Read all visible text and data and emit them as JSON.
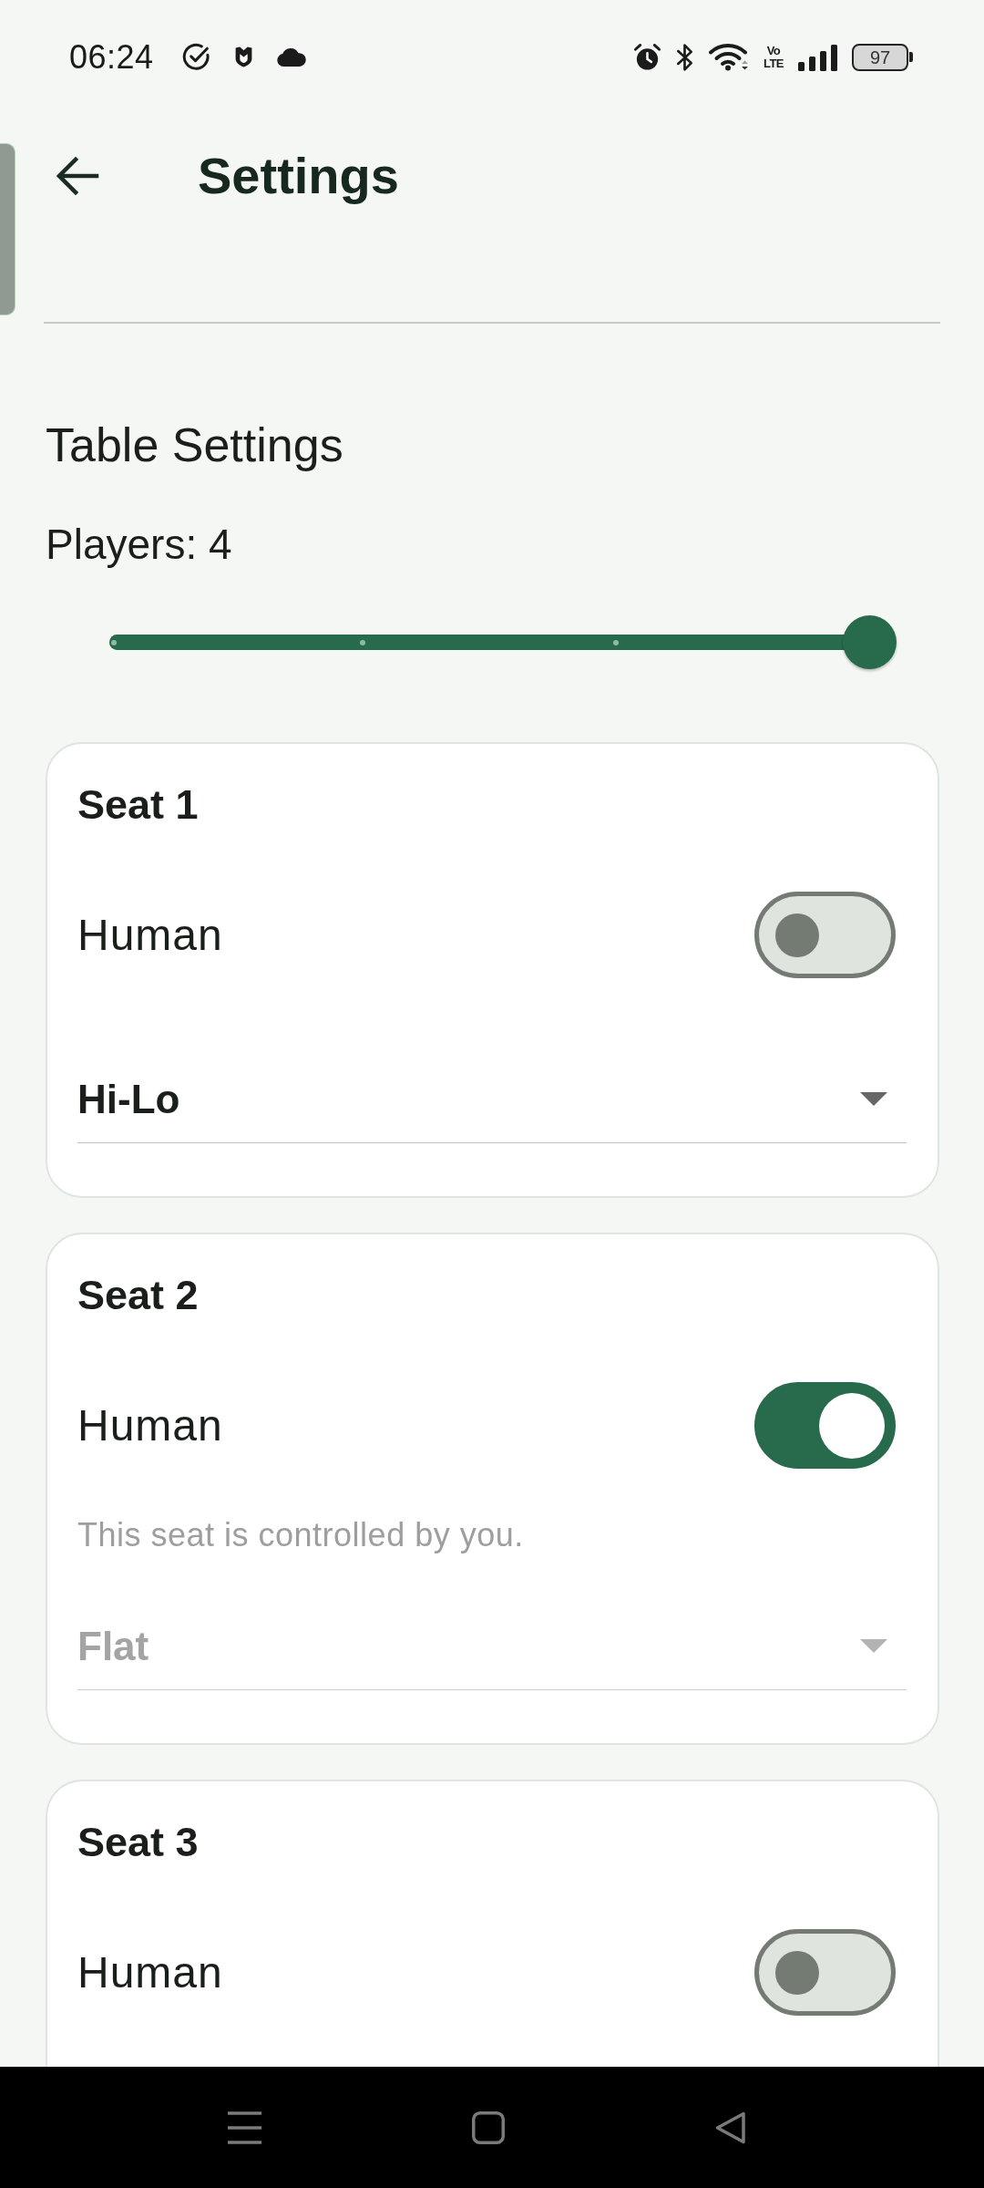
{
  "status_bar": {
    "time": "06:24",
    "network_type": [
      "Vo",
      "LTE"
    ],
    "battery": "97"
  },
  "header": {
    "title": "Settings"
  },
  "section": {
    "title": "Table Settings"
  },
  "players": {
    "label": "Players: 4",
    "level": 1
  },
  "seats": [
    {
      "title": "Seat 1",
      "toggle": {
        "label": "Human",
        "on": false
      },
      "dropdown": {
        "value": "Hi-Lo",
        "disabled": false
      }
    },
    {
      "title": "Seat 2",
      "toggle": {
        "label": "Human",
        "on": true
      },
      "helper": "This seat is controlled by you.",
      "dropdown": {
        "value": "Flat",
        "disabled": true
      }
    },
    {
      "title": "Seat 3",
      "toggle": {
        "label": "Human",
        "on": false
      }
    }
  ]
}
